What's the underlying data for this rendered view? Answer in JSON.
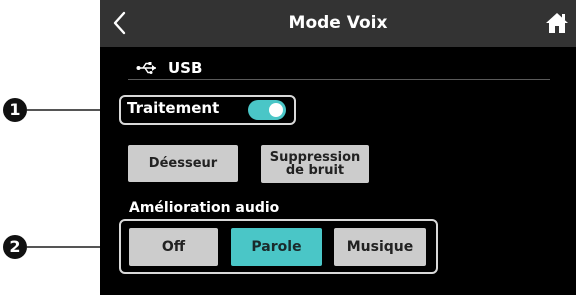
{
  "titlebar": {
    "title": "Mode Voix",
    "back_icon": "chevron-left-icon",
    "home_icon": "home-icon"
  },
  "source": {
    "icon": "usb-icon",
    "label": "USB"
  },
  "processing": {
    "label": "Traitement",
    "toggle_on": true
  },
  "effects": {
    "deesser_label": "Déesseur",
    "noise_line1": "Suppression",
    "noise_line2": "de bruit"
  },
  "enhancement": {
    "label": "Amélioration audio",
    "options": [
      "Off",
      "Parole",
      "Musique"
    ],
    "selected": "Parole"
  },
  "callouts": {
    "one": "1",
    "two": "2"
  },
  "colors": {
    "accent": "#4ac6c7",
    "titlebar": "#333333",
    "button": "#cccccc",
    "background": "#000000"
  }
}
